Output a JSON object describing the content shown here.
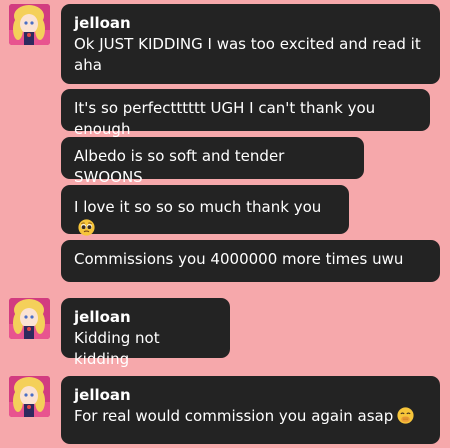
{
  "chat": {
    "groups": [
      {
        "username": "jelloan",
        "messages": [
          "Ok JUST KIDDING I was too excited and read it aha",
          "It's so perfectttttt UGH I can't thank you enough",
          "Albedo is so soft and tender SWOONS",
          "I love it so so so much thank you",
          "Commissions you 4000000 more times uwu"
        ]
      },
      {
        "username": "jelloan",
        "messages": [
          "Kidding not kidding"
        ]
      },
      {
        "username": "jelloan",
        "messages": [
          "For real would commission you again asap"
        ]
      }
    ]
  },
  "icons": {
    "pleading_emoji": "pleading-face-emoji",
    "hand_over_mouth_emoji": "face-with-hand-over-mouth-emoji",
    "avatar": "sailor-moon-avatar"
  },
  "colors": {
    "background": "#f6a8ab",
    "bubble": "#232323",
    "text": "#ffffff"
  }
}
